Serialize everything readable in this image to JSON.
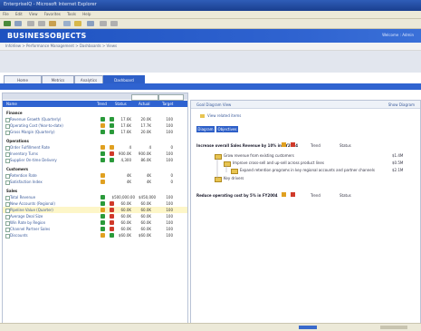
{
  "window": {
    "title": "EnterpriseIQ - Microsoft Internet Explorer"
  },
  "menu": [
    "File",
    "Edit",
    "View",
    "Favorites",
    "Tools",
    "Help"
  ],
  "banner": {
    "brand": "BUSINESSOBJECTS",
    "welcome": "Welcome : Admin"
  },
  "breadcrumb": "InfoView > Performance Management > Dashboards > Views",
  "tabs": [
    {
      "label": "Home",
      "active": false
    },
    {
      "label": "Metrics",
      "active": false
    },
    {
      "label": "Analytics",
      "active": false
    },
    {
      "label": "Dashboard",
      "active": true
    }
  ],
  "left_pane": {
    "columns": [
      "Name",
      "Trend",
      "Status",
      "Actual",
      "Target"
    ],
    "groups": [
      {
        "label": "Finance",
        "rows": [
          {
            "label": "Revenue Growth (Quarterly)",
            "actual": "17.6K",
            "target": "20.0K",
            "extra": "100"
          },
          {
            "label": "Operating Cost (Year-to-date)",
            "actual": "17.6K",
            "target": "17.7K",
            "extra": "100"
          },
          {
            "label": "Gross Margin (Quarterly)",
            "actual": "17.6K",
            "target": "20.0K",
            "extra": "100"
          }
        ]
      },
      {
        "label": "Operations",
        "rows": [
          {
            "label": "Order Fulfillment Rate",
            "actual": "4",
            "target": "4",
            "extra": "0"
          },
          {
            "label": "Inventory Turns",
            "actual": "900.0K",
            "target": "900.0K",
            "extra": "100"
          },
          {
            "label": "Supplier On-time Delivery",
            "actual": "4,300",
            "target": "86.0K",
            "extra": "100"
          }
        ]
      },
      {
        "label": "Customers",
        "rows": [
          {
            "label": "Retention Rate",
            "actual": "4K",
            "target": "4K",
            "extra": "0"
          },
          {
            "label": "Satisfaction Index",
            "actual": "4K",
            "target": "4K",
            "extra": "0"
          }
        ]
      },
      {
        "label": "Sales",
        "rows": [
          {
            "label": "Total Revenue",
            "actual": "$500,000.00",
            "target": "$450,000",
            "extra": "100"
          },
          {
            "label": "New Accounts (Regional)",
            "actual": "60.0K",
            "target": "60.0K",
            "extra": "100"
          },
          {
            "label": "Pipeline Value (Quarter)",
            "actual": "60.0K",
            "target": "60.0K",
            "extra": "100"
          },
          {
            "label": "Average Deal Size",
            "actual": "60.0K",
            "target": "60.0K",
            "extra": "100"
          },
          {
            "label": "Win Rate by Region",
            "actual": "60.0K",
            "target": "60.0K",
            "extra": "100"
          },
          {
            "label": "Channel Partner Sales",
            "actual": "60.0K",
            "target": "60.0K",
            "extra": "100"
          },
          {
            "label": "Discounts",
            "actual": "$60.0K",
            "target": "$60.0K",
            "extra": "100"
          }
        ]
      }
    ]
  },
  "right_pane": {
    "header_title": "Goal Diagram View",
    "header_right": "Show Diagram",
    "link": "View related items",
    "buttons": [
      "Diagram",
      "Objectives"
    ],
    "goal1": {
      "title": "Increase overall Sales Revenue by 10% in FY2004",
      "trend_label": "Trend",
      "status_label": "Status"
    },
    "tree": [
      "Grow revenue from existing customers",
      "Improve cross-sell and up-sell across product lines",
      "Expand retention programs in key regional accounts and partner channels",
      "Key drivers"
    ],
    "side_values": [
      "$1.4M",
      "$0.5M",
      "$2.1M"
    ],
    "goal2": {
      "title": "Reduce operating cost by 5% in FY2004",
      "trend_label": "Trend",
      "status_label": "Status"
    }
  },
  "colors": {
    "brand_blue": "#2f63d0",
    "good": "#2a9a3a",
    "warn": "#e0a020",
    "bad": "#d03a2a"
  }
}
